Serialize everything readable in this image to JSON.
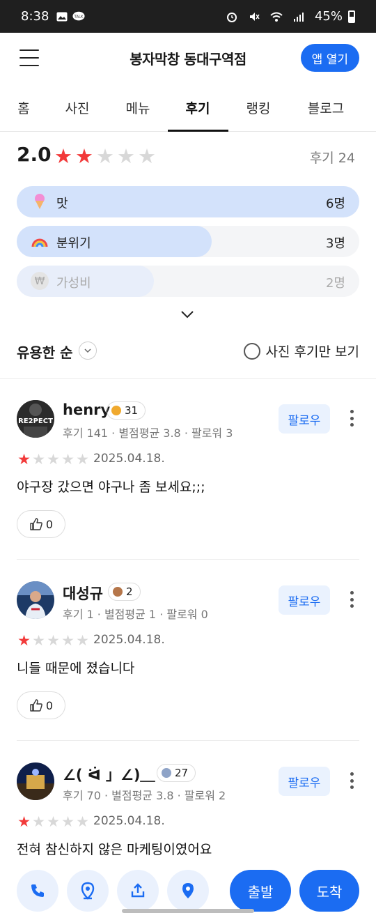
{
  "status_bar": {
    "time": "8:38",
    "battery": "45%",
    "talk_label": "TALK"
  },
  "header": {
    "title": "봉자막창 동대구역점",
    "open_app_label": "앱 열기"
  },
  "tabs": [
    "홈",
    "사진",
    "메뉴",
    "후기",
    "랭킹",
    "블로그"
  ],
  "active_tab": "후기",
  "summary": {
    "score": "2.0",
    "stars": 2,
    "review_count_label": "후기 24",
    "categories": [
      {
        "label": "맛",
        "count": "6명",
        "emoji": "🍦"
      },
      {
        "label": "분위기",
        "count": "3명",
        "emoji": "🌈"
      },
      {
        "label": "가성비",
        "count": "2명",
        "emoji": "₩"
      }
    ]
  },
  "sort": {
    "label": "유용한 순",
    "photo_only_label": "사진 후기만 보기"
  },
  "reviews": [
    {
      "name": "henry",
      "badge": "31",
      "badge_color": "#f0a92e",
      "meta": "후기 141 · 별점평균 3.8 · 팔로워 3",
      "stars": 1,
      "date": "2025.04.18.",
      "text": "야구장 갔으면 야구나 좀 보세요;;;",
      "likes": "0",
      "follow_label": "팔로우",
      "avatar_text": "RE2PECT"
    },
    {
      "name": "대성규",
      "badge": "2",
      "badge_color": "#b5764a",
      "meta": "후기 1 · 별점평균 1 · 팔로워 0",
      "stars": 1,
      "date": "2025.04.18.",
      "text": "니들 때문에 졌습니다",
      "likes": "0",
      "follow_label": "팔로우",
      "avatar_text": ""
    },
    {
      "name": "∠( ᐛ 」∠)＿",
      "badge": "27",
      "badge_color": "#8ea3c7",
      "meta": "후기 70 · 별점평균 3.8 · 팔로워 2",
      "stars": 1,
      "date": "2025.04.18.",
      "text": "전혀 참신하지 않은 마케팅이였어요",
      "likes": "0",
      "follow_label": "팔로우",
      "avatar_text": ""
    }
  ],
  "bottom_bar": {
    "depart_label": "출발",
    "arrive_label": "도착"
  },
  "colors": {
    "accent": "#1b6cf2",
    "star": "#f23a3a",
    "bar_fill": "#d3e2fb"
  }
}
